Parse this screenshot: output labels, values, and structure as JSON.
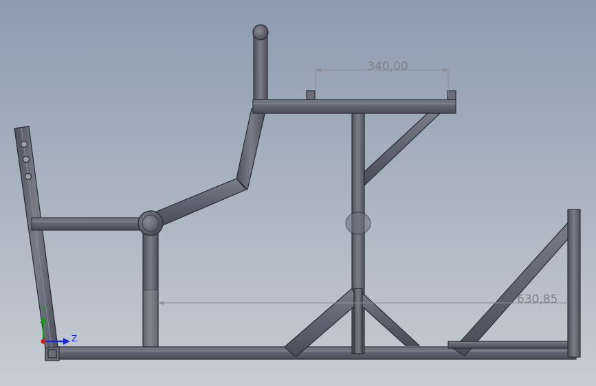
{
  "viewport": {
    "background_top": "#8d9cb0",
    "background_bottom": "#c7ccd4"
  },
  "dimensions": {
    "horizontal_label": "340,00",
    "height_label": "630,85"
  },
  "triad": {
    "y_label": "Y",
    "z_label": "Z",
    "y_color": "#1a9a1a",
    "z_color": "#1a2ad0",
    "x_color": "#d01a1a"
  },
  "colors": {
    "tube": "#5b5e6b",
    "tube_edge": "#2a2c34",
    "tube_highlight": "#8a8d99",
    "dimension_line": "#8a8f96"
  }
}
